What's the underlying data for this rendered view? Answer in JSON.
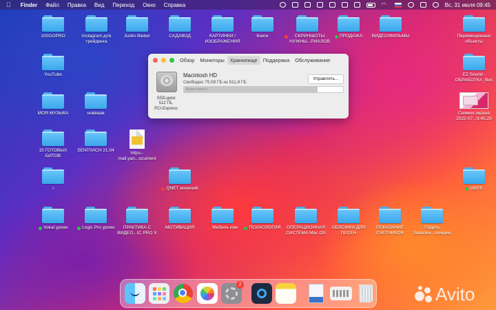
{
  "menubar": {
    "apple": "",
    "app_name": "Finder",
    "items": [
      "Файл",
      "Правка",
      "Вид",
      "Переход",
      "Окно",
      "Справка"
    ],
    "datetime": "Вс, 31 июля  09:45"
  },
  "desktop": {
    "icons": [
      {
        "label": "100GOPRO",
        "kind": "folder",
        "dot": null
      },
      {
        "label": "Instagram для\nтрейдинга",
        "kind": "folder",
        "dot": null
      },
      {
        "label": "Justin Bieber",
        "kind": "folder",
        "dot": null
      },
      {
        "label": "САДАВОД",
        "kind": "folder",
        "dot": null
      },
      {
        "label": "КАРТИНКИ /\nИЗОБРАЖЕНИЯ",
        "kind": "folder",
        "dot": null
      },
      {
        "label": "Книги",
        "kind": "folder",
        "dot": null
      },
      {
        "label": "СКРИНШОТЫ\nНУЖНЫ...РИАЛОВ",
        "kind": "folder",
        "dot": "#ff3b30"
      },
      {
        "label": "ПРОДАЖА",
        "kind": "folder",
        "dot": "#28c840"
      },
      {
        "label": "ВИДЕО/ФИЛЬМЫ",
        "kind": "folder",
        "dot": null
      },
      {
        "label": "Перемещенные\nобъекты",
        "kind": "folder",
        "dot": null
      },
      {
        "label": "YouTube",
        "kind": "folder",
        "dot": null
      },
      {
        "label": "EZ Sound -\nОБРАБОТКА_files",
        "kind": "folder",
        "dot": null
      },
      {
        "label": "МОЯ МУЗЫКА",
        "kind": "folder",
        "dot": null
      },
      {
        "label": "новвaaв",
        "kind": "folder",
        "dot": null
      },
      {
        "label": "Снимок экрана\n2022-07...9.45.29",
        "kind": "screenshot",
        "dot": null
      },
      {
        "label": "15 ГОТОВЫХ\nБИТОВ",
        "kind": "folder",
        "dot": null
      },
      {
        "label": "SENTIVICH 21.04",
        "kind": "folder",
        "dot": null
      },
      {
        "label": "https--\nmail.yan...ocument",
        "kind": "document",
        "dot": null
      },
      {
        "label": "♪",
        "kind": "folder",
        "dot": null
      },
      {
        "label": "QNET вонючий",
        "kind": "folder",
        "dot": "#ff3b30"
      },
      {
        "label": "LIKEE",
        "kind": "folder",
        "dot": "#28c840"
      },
      {
        "label": "Vokal уроки",
        "kind": "folder",
        "dot": "#28c840"
      },
      {
        "label": "Logic Pro уроки",
        "kind": "folder",
        "dot": "#28c840"
      },
      {
        "label": "ПРАКТИКА С\nВИДЕО...IC PRO X",
        "kind": "folder",
        "dot": null
      },
      {
        "label": "МОТИВАЦИЯ",
        "kind": "folder",
        "dot": null
      },
      {
        "label": "Мебель ком",
        "kind": "folder",
        "dot": "#ff3b30"
      },
      {
        "label": "ПСИХОЛОГИЯ",
        "kind": "folder",
        "dot": "#28c840"
      },
      {
        "label": "ОПЕРАЦИОННАЯ\nСИСТЕМА Mac OS",
        "kind": "folder",
        "dot": null
      },
      {
        "label": "ОБЛОЖКИ ДЛЯ\nПЕСЕН",
        "kind": "folder",
        "dot": null
      },
      {
        "label": "ПОКАЗАНИЕ\nСЧЕТЧИКОВ",
        "kind": "folder",
        "dot": null
      },
      {
        "label": "Подать\nЗаявлен...олицию",
        "kind": "folder",
        "dot": null
      }
    ]
  },
  "about_window": {
    "tabs": [
      "Обзор",
      "Мониторы",
      "Хранилище",
      "Поддержка",
      "Обслуживание"
    ],
    "active_tab": "Хранилище",
    "drive_name": "Macintosh HD",
    "free_text": "Свободно 75,59 ГБ из 511,9 ГБ",
    "manage_label": "Управлять...",
    "calculating": "Вычисляется...",
    "used_fraction": 0.84,
    "drive_label": "SSD-диск\n512 ГБ,\nPCI-Express"
  },
  "dock": {
    "apps": [
      {
        "name": "finder-icon",
        "badge": null
      },
      {
        "name": "launchpad-icon",
        "badge": null
      },
      {
        "name": "chrome-icon",
        "badge": null
      },
      {
        "name": "photos-icon",
        "badge": null
      },
      {
        "name": "system-preferences-icon",
        "badge": "2"
      },
      {
        "name": "quicktime-icon",
        "badge": null
      },
      {
        "name": "notes-icon",
        "badge": null
      },
      {
        "name": "preview-icon",
        "badge": null
      },
      {
        "name": "keyboard-viewer-icon",
        "badge": null
      },
      {
        "name": "trash-icon",
        "badge": null
      }
    ]
  },
  "watermark": {
    "text": "Avito"
  },
  "colors": {
    "folder": "#4db4f2",
    "tag_red": "#ff3b30",
    "tag_green": "#28c840"
  }
}
